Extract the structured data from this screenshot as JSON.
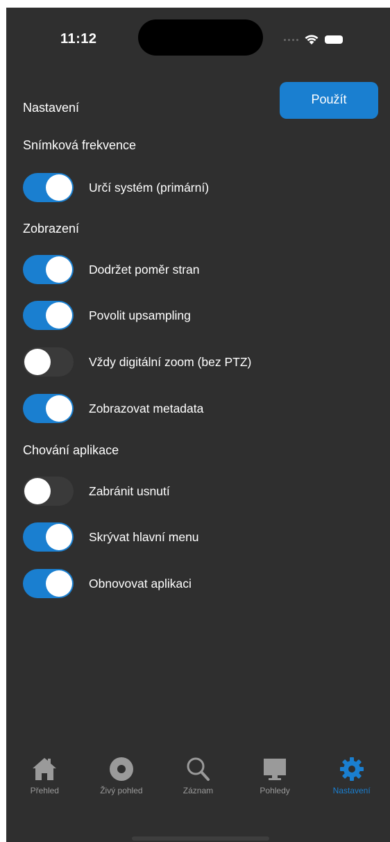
{
  "status_bar": {
    "time": "11:12"
  },
  "header": {
    "title": "Nastavení",
    "apply_label": "Použít"
  },
  "sections": {
    "frame_rate": {
      "title": "Snímková frekvence",
      "items": [
        {
          "label": "Určí systém (primární)",
          "on": true
        }
      ]
    },
    "display": {
      "title": "Zobrazení",
      "items": [
        {
          "label": "Dodržet poměr stran",
          "on": true
        },
        {
          "label": "Povolit upsampling",
          "on": true
        },
        {
          "label": "Vždy digitální zoom (bez PTZ)",
          "on": false
        },
        {
          "label": "Zobrazovat metadata",
          "on": true
        }
      ]
    },
    "app_behavior": {
      "title": "Chování aplikace",
      "items": [
        {
          "label": "Zabránit usnutí",
          "on": false
        },
        {
          "label": "Skrývat hlavní menu",
          "on": true
        },
        {
          "label": "Obnovovat aplikaci",
          "on": true
        }
      ]
    }
  },
  "tab_bar": {
    "tabs": [
      {
        "label": "Přehled",
        "icon": "house-icon",
        "active": false
      },
      {
        "label": "Živý pohled",
        "icon": "live-circle-icon",
        "active": false
      },
      {
        "label": "Záznam",
        "icon": "magnifier-icon",
        "active": false
      },
      {
        "label": "Pohledy",
        "icon": "monitor-icon",
        "active": false
      },
      {
        "label": "Nastavení",
        "icon": "gear-icon",
        "active": true
      }
    ]
  },
  "colors": {
    "background": "#2f2f2f",
    "accent": "#1a7fd0",
    "toggle_off": "#3a3a3a",
    "inactive_tab": "#9a9a9a"
  }
}
